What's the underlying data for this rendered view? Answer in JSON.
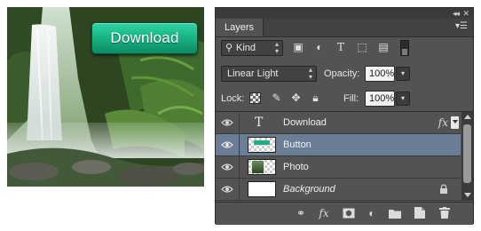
{
  "preview": {
    "button_text": "Download"
  },
  "panel": {
    "window_controls": {
      "collapse": "◂◂",
      "close": "✕"
    },
    "tab": "Layers",
    "filter": {
      "search_icon": "magnifier-icon",
      "kind_label": "Kind",
      "filter_icons": [
        "image-filter-icon",
        "adjustment-filter-icon",
        "type-filter-icon",
        "shape-filter-icon",
        "smart-object-filter-icon"
      ]
    },
    "blend": {
      "mode": "Linear Light",
      "opacity_label": "Opacity:",
      "opacity_value": "100%"
    },
    "lock": {
      "label": "Lock:",
      "icons": [
        "lock-transparent-icon",
        "lock-paint-icon",
        "lock-move-icon",
        "lock-all-icon"
      ],
      "fill_label": "Fill:",
      "fill_value": "100%"
    },
    "layers": [
      {
        "name": "Download",
        "kind": "text",
        "type_glyph": "T",
        "selected": false,
        "has_fx": true,
        "fx_label": "fx"
      },
      {
        "name": "Button",
        "kind": "shape",
        "selected": true
      },
      {
        "name": "Photo",
        "kind": "image",
        "selected": false
      },
      {
        "name": "Background",
        "kind": "background",
        "selected": false,
        "locked": true
      }
    ],
    "footer_icons": [
      "link-icon",
      "fx-icon",
      "mask-icon",
      "adjustment-icon",
      "group-folder-icon",
      "new-layer-icon",
      "trash-icon"
    ],
    "footer_fx_label": "fx",
    "colors": {
      "panel_bg": "#535353",
      "selected_row": "#6b7e96",
      "button_green": "#19b585"
    }
  }
}
